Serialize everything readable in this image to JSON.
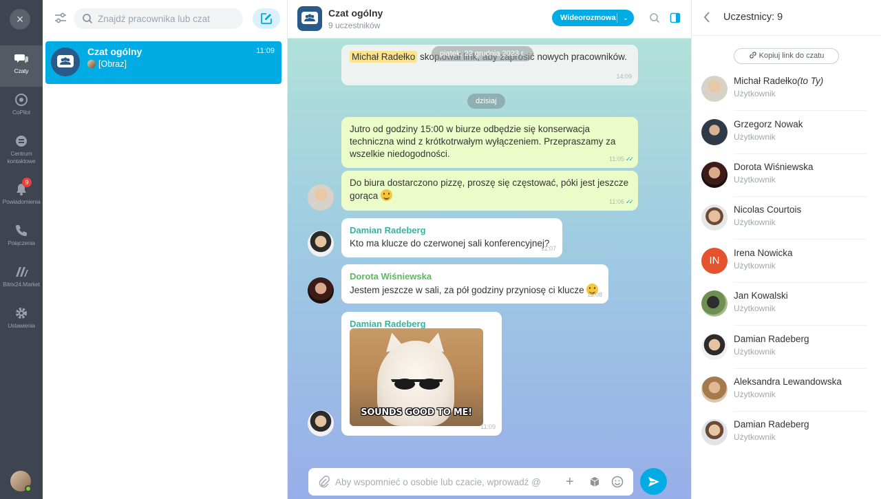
{
  "rail": {
    "close_label": "×",
    "items": [
      {
        "label": "Czaty",
        "icon": "chat-bubbles-icon"
      },
      {
        "label": "CoPilot",
        "icon": "copilot-icon"
      },
      {
        "label": "Centrum kontaktowe",
        "icon": "contact-center-icon"
      },
      {
        "label": "Powiadomienia",
        "icon": "bell-icon",
        "badge": "9"
      },
      {
        "label": "Połączenia",
        "icon": "phone-icon"
      },
      {
        "label": "Bitrix24.Market",
        "icon": "market-icon"
      },
      {
        "label": "Ustawienia",
        "icon": "gear-icon"
      }
    ]
  },
  "list": {
    "search_placeholder": "Znajdź pracownika lub czat",
    "chats": [
      {
        "name": "Czat ogólny",
        "time": "11:09",
        "preview": "[Obraz]",
        "active": true
      }
    ]
  },
  "header": {
    "title": "Czat ogólny",
    "subtitle": "9 uczestników",
    "video_label": "Wideorozmowa",
    "video_caret": "⌄"
  },
  "messages": {
    "top_date": "piątek, 22 grudnia 2023 r.",
    "m1_mention": "Michał Radełko",
    "m1_text": " skopiował link, aby zaprosić nowych pracowników.",
    "m1_time": "14:09",
    "today_label": "dzisiaj",
    "m2_text": "Jutro od godziny 15:00 w biurze odbędzie się konserwacja techniczna wind z krótkotrwałym wyłączeniem. Przepraszamy za wszelkie niedogodności.",
    "m2_time": "11:05",
    "m3_text": "Do biura dostarczono pizzę, proszę się częstować, póki jest jeszcze gorąca ",
    "m3_time": "11:06",
    "m4_author": "Damian Radeberg",
    "m4_text": "Kto ma klucze do czerwonej sali konferencyjnej?",
    "m4_time": "11:07",
    "m5_author": "Dorota Wiśniewska",
    "m5_text": "Jestem jeszcze w sali, za pół godziny przyniosę ci klucze ",
    "m5_time": "11:08",
    "m6_author": "Damian Radeberg",
    "m6_caption": "SOUNDS GOOD TO ME!",
    "m6_time": "11:09",
    "check_mark": "✓✓",
    "author_colors": {
      "damian": "#3bb0a0",
      "dorota": "#5cb85c"
    }
  },
  "composer": {
    "placeholder": "Aby wspomnieć o osobie lub czacie, wprowadź @",
    "plus": "+"
  },
  "panel": {
    "title": "Uczestnicy: 9",
    "copy_link": "Kopiuj link do czatu",
    "members": [
      {
        "name": "Michał Radełko",
        "suffix": "(to Ty)",
        "role": "Użytkownik"
      },
      {
        "name": "Grzegorz Nowak",
        "role": "Użytkownik"
      },
      {
        "name": "Dorota Wiśniewska",
        "role": "Użytkownik"
      },
      {
        "name": "Nicolas Courtois",
        "role": "Użytkownik"
      },
      {
        "name": "Irena Nowicka",
        "role": "Użytkownik",
        "initials": "IN"
      },
      {
        "name": "Jan Kowalski",
        "role": "Użytkownik"
      },
      {
        "name": "Damian Radeberg",
        "role": "Użytkownik"
      },
      {
        "name": "Aleksandra Lewandowska",
        "role": "Użytkownik"
      },
      {
        "name": "Damian Radeberg",
        "role": "Użytkownik"
      }
    ]
  },
  "colors": {
    "accent": "#00ace3",
    "rail": "#3e4550",
    "mine_bubble": "#ebfcc9",
    "badge": "#e8403c"
  }
}
